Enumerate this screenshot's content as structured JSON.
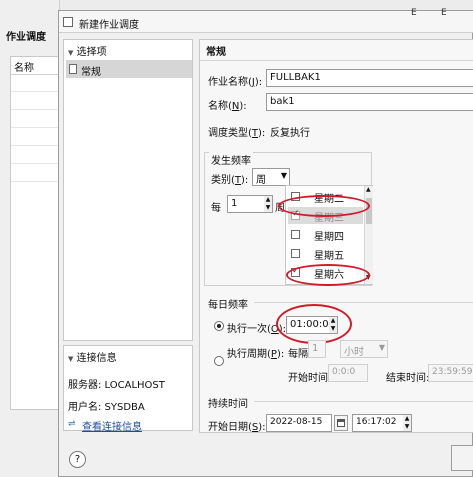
{
  "background_window": {
    "title": "作业调度",
    "column_name": "名称"
  },
  "dialog": {
    "title": "新建作业调度",
    "right_top_glyphs": [
      "E",
      "E"
    ],
    "left": {
      "select_header": "选择项",
      "select_item": "常规",
      "conn_header": "连接信息",
      "server_label": "服务器: LOCALHOST",
      "user_label": "用户名: SYSDBA",
      "view_conn_link": "查看连接信息"
    },
    "right": {
      "section_title": "常规",
      "job_name_label": "作业名称(",
      "job_name_key": "J",
      "job_name_tail": "):",
      "job_name_value": "FULLBAK1",
      "name_label": "名称(",
      "name_key": "N",
      "name_tail": "):",
      "name_value": "bak1",
      "schedule_type_label": "调度类型(",
      "schedule_type_key": "T",
      "schedule_type_tail": "):",
      "schedule_type_value": "反复执行",
      "frequency_group": "发生频率",
      "category_label": "类别(",
      "category_key": "T",
      "category_tail": "):",
      "category_value": "周",
      "every_label": "每",
      "every_value": "1",
      "every_unit": "周",
      "weekdays": [
        {
          "label": "星期二",
          "checked": false
        },
        {
          "label": "星期三",
          "checked": true
        },
        {
          "label": "星期四",
          "checked": false
        },
        {
          "label": "星期五",
          "checked": false
        },
        {
          "label": "星期六",
          "checked": true
        }
      ],
      "daily_group": "每日频率",
      "exec_once_label": "执行一次(",
      "exec_once_key": "O",
      "exec_once_tail": "):",
      "exec_once_value": "01:00:00",
      "exec_period_label": "执行周期(",
      "exec_period_key": "P",
      "exec_period_tail": "):",
      "every_interval_label": "每隔",
      "every_interval_value": "1",
      "interval_unit": "小时",
      "start_time_label": "开始时间:",
      "start_time_value": "0:0:0",
      "end_time_label": "结束时间:",
      "end_time_value": "23:59:59",
      "duration_group": "持续时间",
      "start_date_label": "开始日期(",
      "start_date_key": "S",
      "start_date_tail": "):",
      "start_date_value": "2022-08-15",
      "start_date_time_value": "16:17:02"
    },
    "help_icon": "?"
  },
  "colors": {
    "annotation_red": "#d11a2a",
    "selection": "#dcdcdc",
    "link": "#1f4fa3"
  }
}
